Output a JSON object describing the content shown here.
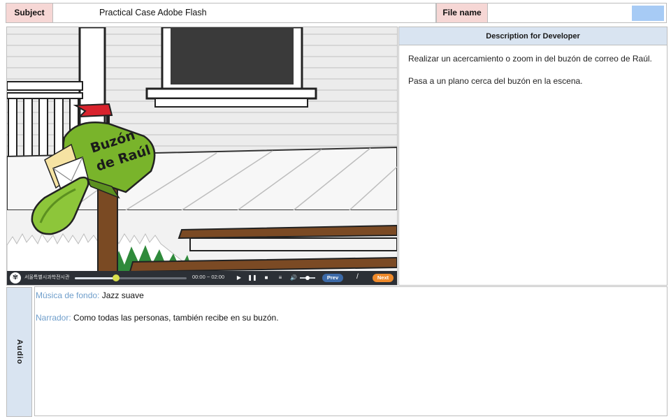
{
  "header": {
    "subject_label": "Subject",
    "subject_value": "Practical Case Adobe Flash",
    "file_label": "File name",
    "file_value": ""
  },
  "scene": {
    "mailbox_text_line1": "Buzón",
    "mailbox_text_line2": "de Raúl"
  },
  "player": {
    "org_text": "서울특별시과학전시관",
    "time": "00:00 ~ 02:00",
    "progress": 0.37,
    "volume": 0.5,
    "prev_label": "Prev",
    "next_label": "Next",
    "separator": "/",
    "icons": [
      "logo-icon",
      "play-icon",
      "pause-icon",
      "stop-icon",
      "menu-icon",
      "volume-icon"
    ]
  },
  "description": {
    "title": "Description for Developer",
    "paragraphs": [
      "Realizar un acercamiento o zoom in del buzón de correo de Raúl.",
      "Pasa a un plano cerca del buzón en la escena."
    ]
  },
  "audio": {
    "label": "Audio",
    "lines": [
      {
        "key": "Música de fondo:",
        "value": "Jazz suave"
      },
      {
        "key": "Narrador:",
        "value": "Como todas las personas, también recibe en su buzón."
      }
    ]
  },
  "colors": {
    "header_label_bg": "#f6d7d5",
    "panel_header_bg": "#d9e4f1",
    "file_swatch": "#a7cbf5",
    "mailbox_green": "#79b42b",
    "flag_red": "#d9232d",
    "player_bg": "#2c3036",
    "prev_button": "#3c6aa8",
    "next_button": "#ef8a2b",
    "audio_key": "#6f9ecb"
  }
}
